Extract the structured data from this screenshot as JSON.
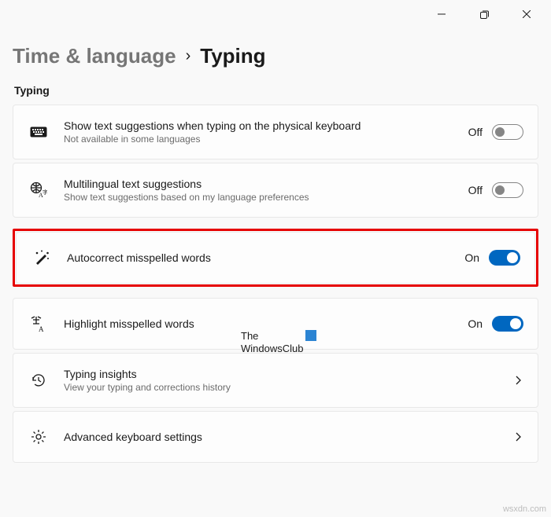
{
  "window": {
    "minimize": "minimize",
    "maximize": "maximize",
    "close": "close"
  },
  "breadcrumb": {
    "parent": "Time & language",
    "separator": "›",
    "current": "Typing"
  },
  "section_label": "Typing",
  "state": {
    "on": "On",
    "off": "Off"
  },
  "items": {
    "suggestions": {
      "title": "Show text suggestions when typing on the physical keyboard",
      "subtitle": "Not available in some languages",
      "state": "off"
    },
    "multilingual": {
      "title": "Multilingual text suggestions",
      "subtitle": "Show text suggestions based on my language preferences",
      "state": "off"
    },
    "autocorrect": {
      "title": "Autocorrect misspelled words",
      "state": "on"
    },
    "highlight": {
      "title": "Highlight misspelled words",
      "state": "on"
    },
    "insights": {
      "title": "Typing insights",
      "subtitle": "View your typing and corrections history"
    },
    "advanced": {
      "title": "Advanced keyboard settings"
    }
  },
  "watermark": {
    "line1": "The",
    "line2": "WindowsClub",
    "corner": "wsxdn.com"
  }
}
